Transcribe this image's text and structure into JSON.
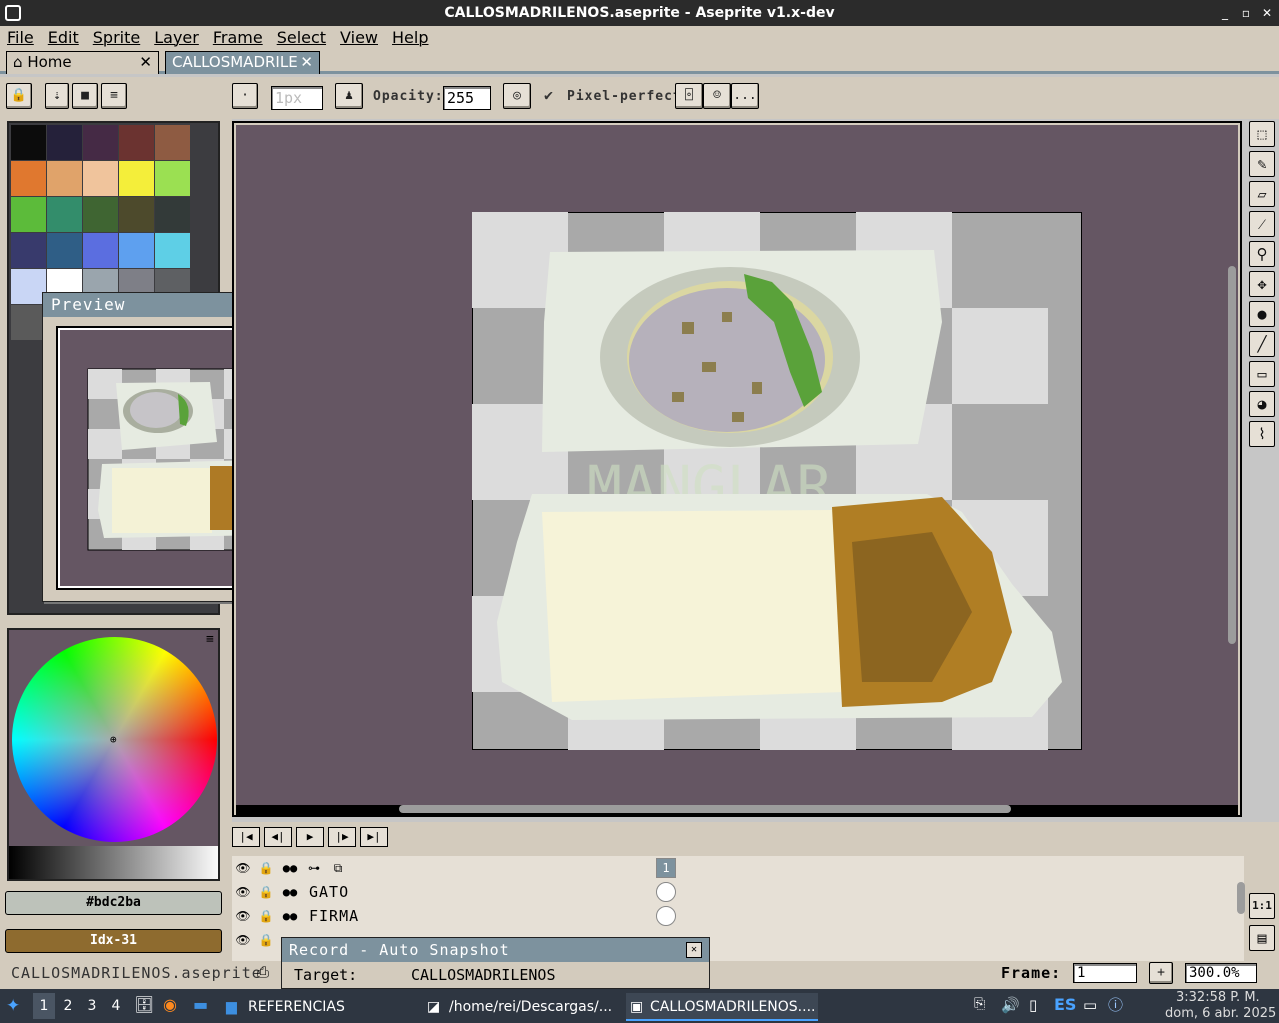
{
  "window": {
    "title": "CALLOSMADRILENOS.aseprite - Aseprite v1.x-dev"
  },
  "menu": [
    "File",
    "Edit",
    "Sprite",
    "Layer",
    "Frame",
    "Select",
    "View",
    "Help"
  ],
  "tabs": {
    "home": "Home",
    "document": "CALLOSMADRILE"
  },
  "toolbar": {
    "brush_size_placeholder": "1px",
    "opacity_label": "Opacity:",
    "opacity_value": "255",
    "pixel_perfect_label": "Pixel-perfect",
    "more_label": "..."
  },
  "palette": {
    "swatches": [
      "#0c0c0c",
      "#25213a",
      "#452a45",
      "#6b3330",
      "#8e5b42",
      "#e0782f",
      "#e0a36a",
      "#f0c49c",
      "#f4ee3a",
      "#9be052",
      "#5cbb3a",
      "#338d6b",
      "#3f6532",
      "#4d4a2c",
      "#333a39",
      "#383a6c",
      "#2f5e86",
      "#5b6ee0",
      "#5ea0ef",
      "#5ecfe6",
      "#c9d6f5",
      "#ffffff",
      "#9aa5ad",
      "#7e7f87",
      "#5e6063",
      "#5a5a5a",
      "#8c8e3e",
      "#cf9a2a",
      "#a8a8a8",
      "#9c9c9c"
    ]
  },
  "preview": {
    "title": "Preview"
  },
  "color": {
    "foreground_hex": "#bdc2ba",
    "background_label": "Idx-31",
    "foreground": "#bdc2ba",
    "background": "#8e6b2f"
  },
  "canvas": {
    "watermark": "MANGLAR"
  },
  "layers": [
    {
      "name": "",
      "cel": "1"
    },
    {
      "name": "GATO",
      "cel": ""
    },
    {
      "name": "FIRMA",
      "cel": ""
    }
  ],
  "record": {
    "title": "Record - Auto Snapshot",
    "target_label": "Target:",
    "target_value": "CALLOSMADRILENOS"
  },
  "status": {
    "filename": "CALLOSMADRILENOS.aseprite",
    "frame_label": "Frame:",
    "frame_value": "1",
    "zoom_value": "300.0%"
  },
  "zoom_buttons": {
    "one_to_one": "1:1"
  },
  "taskbar": {
    "workspaces": [
      "1",
      "2",
      "3",
      "4"
    ],
    "tasks": [
      "REFERENCIAS",
      "/home/rei/Descargas/...",
      "CALLOSMADRILENOS...."
    ],
    "language": "ES",
    "time": "3:32:58 P. M.",
    "date": "dom, 6 abr. 2025"
  }
}
